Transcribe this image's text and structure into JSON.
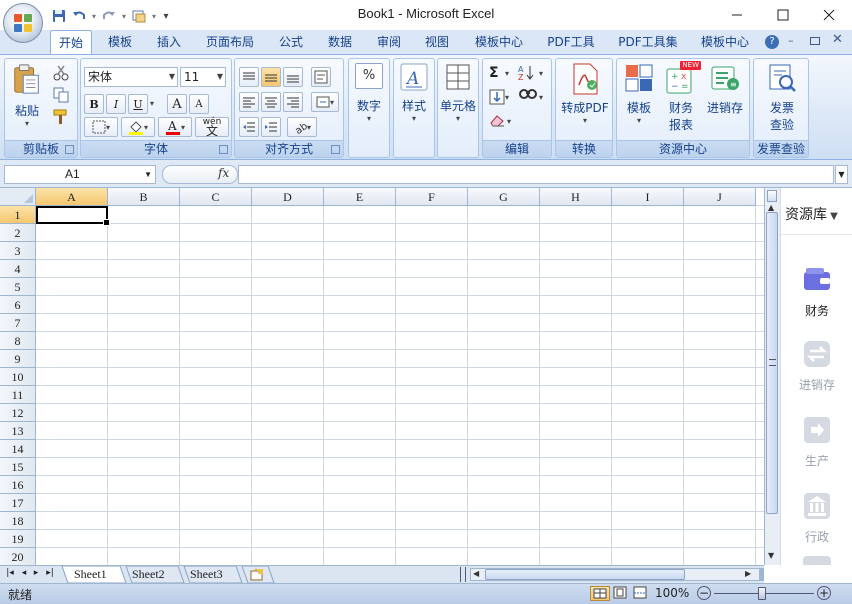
{
  "title_bar": {
    "title": "Book1 - Microsoft Excel",
    "qat_dropdown": "▾"
  },
  "tabs": [
    {
      "label": "开始",
      "active": true
    },
    {
      "label": "模板"
    },
    {
      "label": "插入"
    },
    {
      "label": "页面布局"
    },
    {
      "label": "公式"
    },
    {
      "label": "数据"
    },
    {
      "label": "审阅"
    },
    {
      "label": "视图"
    },
    {
      "label": "模板中心"
    },
    {
      "label": "PDF工具"
    },
    {
      "label": "PDF工具集"
    },
    {
      "label": "模板中心"
    }
  ],
  "ribbon": {
    "clipboard": {
      "paste": "粘贴",
      "label": "剪贴板"
    },
    "font": {
      "name": "宋体",
      "size": "11",
      "bold": "B",
      "italic": "I",
      "underline": "U",
      "grow": "A",
      "shrink": "A",
      "wen": "wén",
      "label": "字体"
    },
    "align": {
      "label": "对齐方式"
    },
    "number": {
      "btn": "数字",
      "icon_text": "%"
    },
    "styles": {
      "btn": "样式"
    },
    "cells": {
      "btn": "单元格"
    },
    "editing": {
      "label": "编辑",
      "sigma": "Σ"
    },
    "convert": {
      "btn": "转成PDF",
      "label": "转换"
    },
    "resource": {
      "template": "模板",
      "finance": "财务",
      "finance2": "报表",
      "invoicing": "进销存",
      "new_badge": "NEW",
      "label": "资源中心"
    },
    "invoice": {
      "btn1": "发票",
      "btn2": "查验",
      "label": "发票查验"
    }
  },
  "formula_bar": {
    "name_box": "A1",
    "fx": "fx",
    "formula": ""
  },
  "grid": {
    "columns": [
      "A",
      "B",
      "C",
      "D",
      "E",
      "F",
      "G",
      "H",
      "I",
      "J"
    ],
    "rows": [
      "1",
      "2",
      "3",
      "4",
      "5",
      "6",
      "7",
      "8",
      "9",
      "10",
      "11",
      "12",
      "13",
      "14",
      "15",
      "16",
      "17",
      "18",
      "19",
      "20"
    ],
    "selected_cell": "A1"
  },
  "resource_panel": {
    "title": "资源库",
    "items": [
      {
        "label": "财务",
        "active": true
      },
      {
        "label": "进销存"
      },
      {
        "label": "生产"
      },
      {
        "label": "行政"
      }
    ]
  },
  "sheets": [
    "Sheet1",
    "Sheet2",
    "Sheet3"
  ],
  "status": {
    "ready": "就绪",
    "zoom": "100%"
  },
  "colors": {
    "ribbon_accent": "#15428b",
    "selection_header": "#f5c76f",
    "resource_active": "#6b6fe0"
  }
}
